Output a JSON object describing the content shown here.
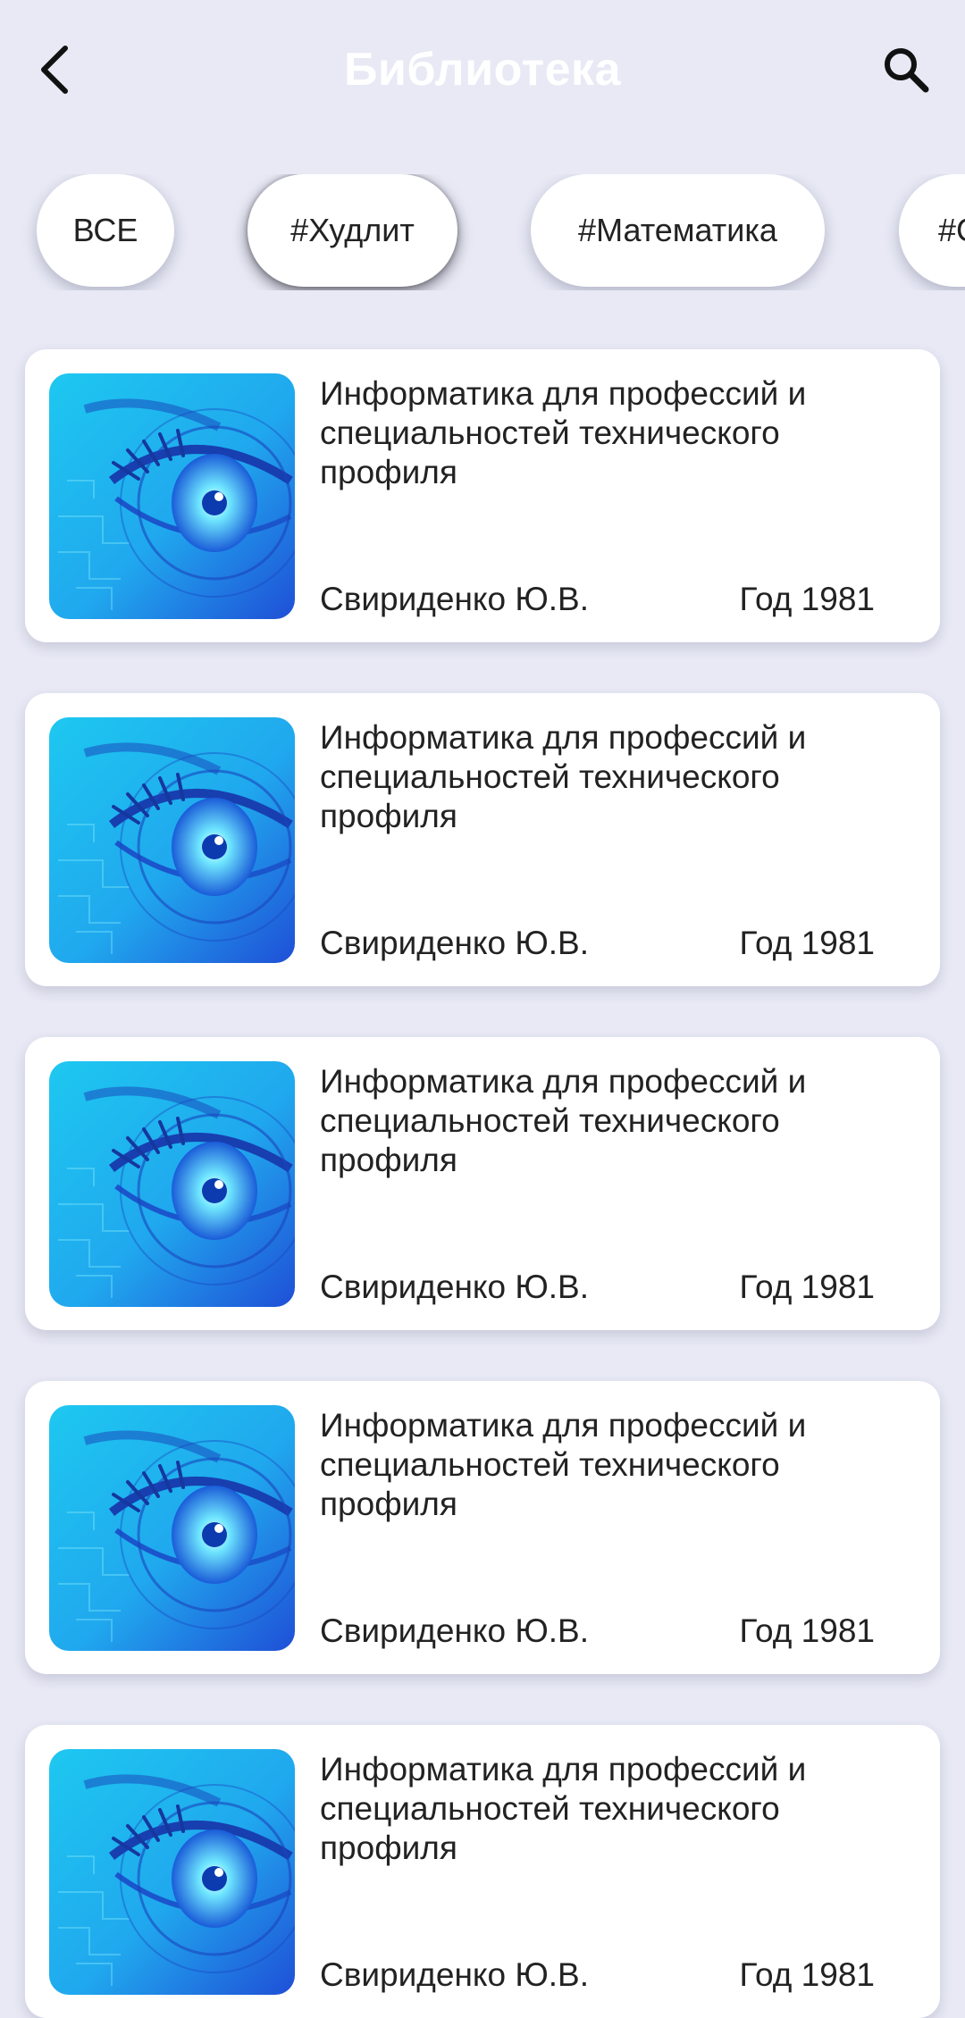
{
  "header": {
    "title": "Библиотека"
  },
  "filters": {
    "chips": [
      "ВСЕ",
      "#Худлит",
      "#Математика",
      "#С"
    ],
    "active_index": 1
  },
  "books": [
    {
      "title": "Информатика для профессий и специальностей технического профиля",
      "author": "Свириденко Ю.В.",
      "year": "Год 1981"
    },
    {
      "title": "Информатика для профессий и специальностей технического профиля",
      "author": "Свириденко Ю.В.",
      "year": "Год 1981"
    },
    {
      "title": "Информатика для профессий и специальностей технического профиля",
      "author": "Свириденко Ю.В.",
      "year": "Год 1981"
    },
    {
      "title": "Информатика для профессий и специальностей технического профиля",
      "author": "Свириденко Ю.В.",
      "year": "Год 1981"
    },
    {
      "title": "Информатика для профессий и специальностей технического профиля",
      "author": "Свириденко Ю.В.",
      "year": "Год 1981"
    }
  ],
  "icons": {
    "back": "chevron-left-icon",
    "search": "search-icon",
    "cover": "eye-cover-image"
  },
  "colors": {
    "background": "#e8e9f5",
    "card": "#ffffff",
    "title_text": "#ffffff",
    "cover_primary": "#1ec8f0",
    "cover_secondary": "#1f4fd6"
  }
}
